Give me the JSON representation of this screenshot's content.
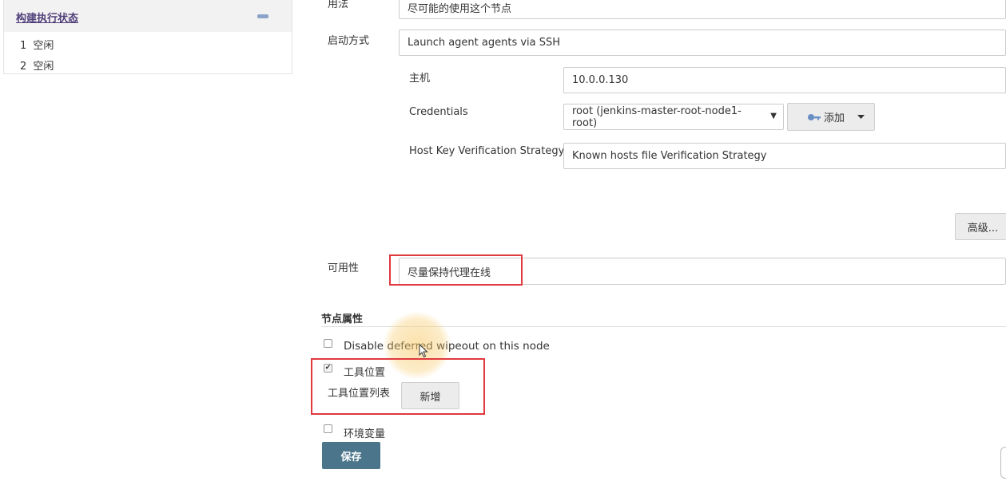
{
  "executors": {
    "title": "构建执行状态",
    "rows": [
      {
        "num": "1",
        "status": "空闲"
      },
      {
        "num": "2",
        "status": "空闲"
      }
    ]
  },
  "form": {
    "usage": {
      "label": "用法",
      "value": "尽可能的使用这个节点"
    },
    "launch": {
      "label": "启动方式",
      "value": "Launch agent agents via SSH"
    },
    "host": {
      "label": "主机",
      "value": "10.0.0.130"
    },
    "credentials": {
      "label": "Credentials",
      "value": "root (jenkins-master-root-node1-root)",
      "add_label": "添加",
      "caret": "▼"
    },
    "host_key": {
      "label": "Host Key Verification Strategy",
      "value": "Known hosts file Verification Strategy"
    },
    "advanced_label": "高级...",
    "availability": {
      "label": "可用性",
      "value": "尽量保持代理在线"
    }
  },
  "node_properties": {
    "title": "节点属性",
    "disable_wipeout": {
      "label": "Disable deferred wipeout on this node",
      "checked": false
    },
    "tool_location": {
      "label": "工具位置",
      "checked": true,
      "check_mark": "✔"
    },
    "tool_list_label": "工具位置列表",
    "add_button": "新增",
    "env_vars": {
      "label": "环境变量",
      "checked": false
    }
  },
  "save_label": "保存",
  "colors": {
    "highlight": "#e0393e",
    "save_button": "#4b758b",
    "executor_title": "#4f3f7a"
  }
}
